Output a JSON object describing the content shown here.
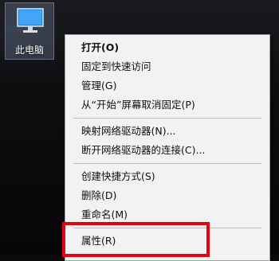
{
  "desktop": {
    "icon": {
      "label": "此电脑",
      "icon_name": "computer-icon"
    }
  },
  "context_menu": {
    "groups": [
      [
        {
          "label": "打开(O)",
          "bold": true
        },
        {
          "label": "固定到快速访问"
        },
        {
          "label": "管理(G)"
        },
        {
          "label": "从“开始”屏幕取消固定(P)"
        }
      ],
      [
        {
          "label": "映射网络驱动器(N)..."
        },
        {
          "label": "断开网络驱动器的连接(C)..."
        }
      ],
      [
        {
          "label": "创建快捷方式(S)"
        },
        {
          "label": "删除(D)"
        },
        {
          "label": "重命名(M)"
        }
      ],
      [
        {
          "label": "属性(R)"
        }
      ]
    ]
  },
  "colors": {
    "highlight": "#e60012",
    "menu_background": "#f2f2f2",
    "separator": "#bdbdbd"
  }
}
